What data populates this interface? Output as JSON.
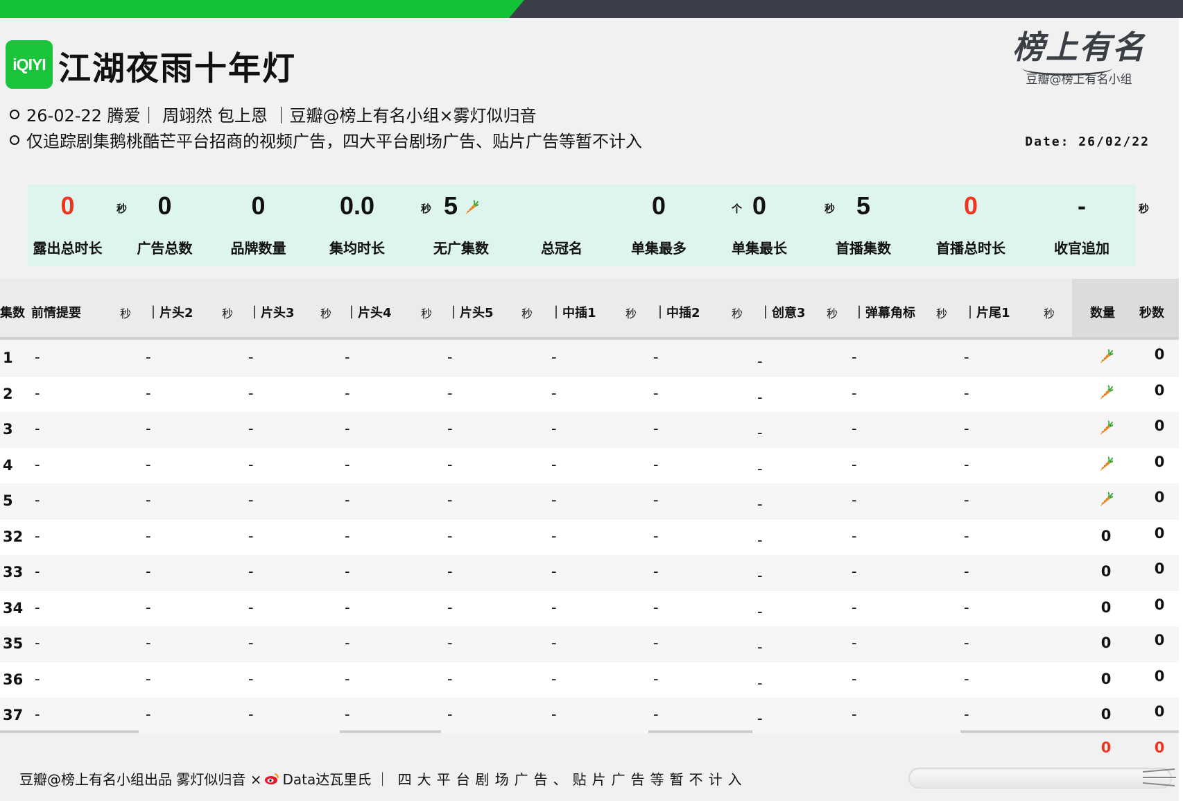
{
  "progress": {
    "fraction": 0.43
  },
  "header": {
    "logo_text": "iQIYI",
    "title": "江湖夜雨十年灯",
    "brand_script": "榜上有名",
    "brand_sub": "豆瓣@榜上有名小组",
    "info_line_1": "26-02-22 腾爱｜ 周翊然 包上恩 ｜豆瓣@榜上有名小组×雾灯似归音",
    "info_line_2": "仅追踪剧集鹅桃酷芒平台招商的视频广告，四大平台剧场广告、贴片广告等暂不计入",
    "date": "Date: 26/02/22"
  },
  "colors": {
    "accent_green": "#13c236",
    "highlight_red": "#f0341e",
    "stats_bg": "#ddf5ee"
  },
  "stats": [
    {
      "value": "0",
      "label": "露出总时长",
      "red": true
    },
    {
      "value": "0",
      "label": "广告总数",
      "red": false
    },
    {
      "value": "0",
      "label": "品牌数量",
      "red": false
    },
    {
      "value": "0.0",
      "label": "集均时长",
      "red": false
    },
    {
      "value": "5",
      "label": "无广集数",
      "red": false
    },
    {
      "value": "",
      "label": "总冠名",
      "red": false
    },
    {
      "value": "0",
      "label": "单集最多",
      "red": false
    },
    {
      "value": "0",
      "label": "单集最长",
      "red": false
    },
    {
      "value": "5",
      "label": "首播集数",
      "red": false
    },
    {
      "value": "0",
      "label": "首播总时长",
      "red": true
    },
    {
      "value": "-",
      "label": "收官追加",
      "red": false
    }
  ],
  "stat_units": {
    "sec": "秒",
    "ge": "个",
    "carrot_icon": "carrot-icon"
  },
  "table": {
    "ep_header": "集数",
    "columns": [
      {
        "label": "前情提要",
        "sec": "秒"
      },
      {
        "label": "｜片头2",
        "sec": "秒"
      },
      {
        "label": "｜片头3",
        "sec": "秒"
      },
      {
        "label": "｜片头4",
        "sec": "秒"
      },
      {
        "label": "｜片头5",
        "sec": "秒"
      },
      {
        "label": "｜中插1",
        "sec": "秒"
      },
      {
        "label": "｜中插2",
        "sec": "秒"
      },
      {
        "label": "｜创意3",
        "sec": "秒"
      },
      {
        "label": "｜弹幕角标",
        "sec": "秒"
      },
      {
        "label": "｜片尾1",
        "sec": "秒"
      }
    ],
    "summary_headers": {
      "count": "数量",
      "seconds": "秒数"
    },
    "dash": "-",
    "rows": [
      {
        "ep": "1",
        "count": "carrot",
        "seconds": "0"
      },
      {
        "ep": "2",
        "count": "carrot",
        "seconds": "0"
      },
      {
        "ep": "3",
        "count": "carrot",
        "seconds": "0"
      },
      {
        "ep": "4",
        "count": "carrot",
        "seconds": "0"
      },
      {
        "ep": "5",
        "count": "carrot",
        "seconds": "0"
      },
      {
        "ep": "32",
        "count": "0",
        "seconds": "0"
      },
      {
        "ep": "33",
        "count": "0",
        "seconds": "0"
      },
      {
        "ep": "34",
        "count": "0",
        "seconds": "0"
      },
      {
        "ep": "35",
        "count": "0",
        "seconds": "0"
      },
      {
        "ep": "36",
        "count": "0",
        "seconds": "0"
      },
      {
        "ep": "37",
        "count": "0",
        "seconds": "0"
      }
    ],
    "totals": {
      "count": "0",
      "seconds": "0"
    }
  },
  "footer": {
    "part1": "豆瓣@榜上有名小组出品  雾灯似归音 ×",
    "weibo_icon": "weibo-icon",
    "part2": "Data达瓦里氏 ｜",
    "part3": "四大平台剧场广告、贴片广告等暂不计入"
  }
}
